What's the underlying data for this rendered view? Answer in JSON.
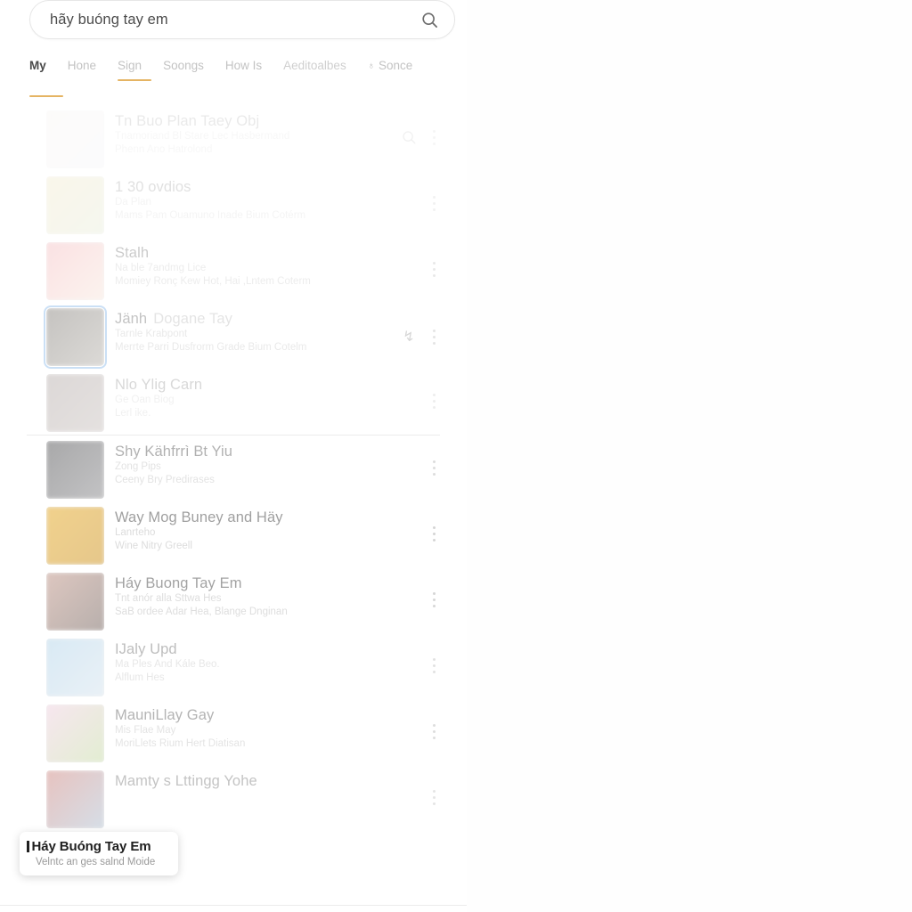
{
  "search": {
    "value": "hãy buóng tay em",
    "icon": "search-icon"
  },
  "tabs": [
    {
      "label": "My",
      "state": "active-dark",
      "underline": "low"
    },
    {
      "label": "Hone",
      "state": "muted",
      "underline": "none"
    },
    {
      "label": "Sign",
      "state": "muted",
      "underline": "high"
    },
    {
      "label": "Soongs",
      "state": "muted",
      "underline": "none"
    },
    {
      "label": "How Is",
      "state": "muted",
      "underline": "none"
    },
    {
      "label": "Aeditoalbes",
      "state": "muted-strong",
      "underline": "none"
    },
    {
      "label": "Sonce",
      "state": "muted",
      "underline": "none",
      "glyph": "person-icon"
    }
  ],
  "accent_color": "#e5b463",
  "selection_color": "#7fb3e8",
  "results": [
    {
      "title": "Tn Buo Plan Taey Obj",
      "sub1": "Tnamoriand Bl Stare  Lec  Hasbermand",
      "sub2": "Phenn  Ano  Hatrolond",
      "thumb_a": "#efe3e0",
      "thumb_b": "#e8eaf0",
      "fade": "f1",
      "badge_search": true,
      "kebab": true
    },
    {
      "title": "1 30 ovdios",
      "sub1": "Da Plan",
      "sub2": "Mams Pam  Ouamuno Inade Bium Cotérm",
      "thumb_a": "#e7d79a",
      "thumb_b": "#cfd8b2",
      "fade": "f2",
      "badge_search": false,
      "kebab": true
    },
    {
      "title": "Stalh",
      "sub1": "Na ble 7andmg Lice",
      "sub2": "Momiey Ronç Kew Hot, Hai ,Lntem Coterm",
      "thumb_a": "#f3a9ae",
      "thumb_b": "#f6ded0",
      "fade": "f3",
      "badge_search": false,
      "kebab": true
    },
    {
      "title_strong": "Jänh",
      "title_faint": "Dogane Tay",
      "sub1": "Tarnle Krabpont",
      "sub2": "Merrte Parri Dusfrorm Grade Bium Cotelm",
      "thumb_a": "#6f6a63",
      "thumb_b": "#a9a49c",
      "fade": "f4",
      "selected": true,
      "badge_cursor": true,
      "kebab": true
    },
    {
      "title": "Nlo Ylig Carn",
      "sub1": "Ge Oan Biog",
      "sub2": "Lerl ike.",
      "thumb_a": "#7b6b66",
      "thumb_b": "#9c8e89",
      "fade": "f5",
      "badge_search": false,
      "kebab": true,
      "divider_after": true
    },
    {
      "title": "Shy Kähfrrì Bt Yiu",
      "sub1": "Zong Pips",
      "sub2": "Ceeny Bry Predirases",
      "thumb_a": "#5a5a5c",
      "thumb_b": "#8d8d90",
      "fade": "f6",
      "badge_search": false,
      "kebab": true
    },
    {
      "title": "Way Mog Buney and Häy",
      "sub1": "Lanrteho",
      "sub2": "Wine Nitry Greell",
      "thumb_a": "#eab94e",
      "thumb_b": "#d8a84a",
      "fade": "f7",
      "badge_search": false,
      "kebab": true
    },
    {
      "title": "Háy Buong Tay Em",
      "sub1": "Tnt anór alla Sttwa Hes",
      "sub2": "SaB ordee Adar Hea, Blange Dnginan",
      "thumb_a": "#c9a59a",
      "thumb_b": "#8d7f7a",
      "fade": "f8",
      "badge_search": false,
      "kebab": true
    },
    {
      "title": "IJaly Upd",
      "sub1": "Ma Ples And Kále Beo.",
      "sub2": "Alflum Hes",
      "thumb_a": "#a9cfe8",
      "thumb_b": "#cfe0ec",
      "fade": "f9",
      "badge_search": false,
      "kebab": true
    },
    {
      "title": "MauniLlay Gay",
      "sub1": "Mis Flae May",
      "sub2": "MoriLlets Rium Hert Diatisan",
      "thumb_a": "#f0cfe0",
      "thumb_b": "#c7dda6",
      "fade": "f10",
      "badge_search": false,
      "kebab": true
    },
    {
      "title": "Mamty s Lttingg Yohe",
      "sub1": "",
      "sub2": "",
      "thumb_a": "#c46a62",
      "thumb_b": "#9aaec4",
      "fade": "f11",
      "badge_search": false,
      "kebab": true
    }
  ],
  "tooltip": {
    "title": "Háy Buóng Tay Em",
    "subtitle": "Velntc an ges salnd Moide"
  }
}
